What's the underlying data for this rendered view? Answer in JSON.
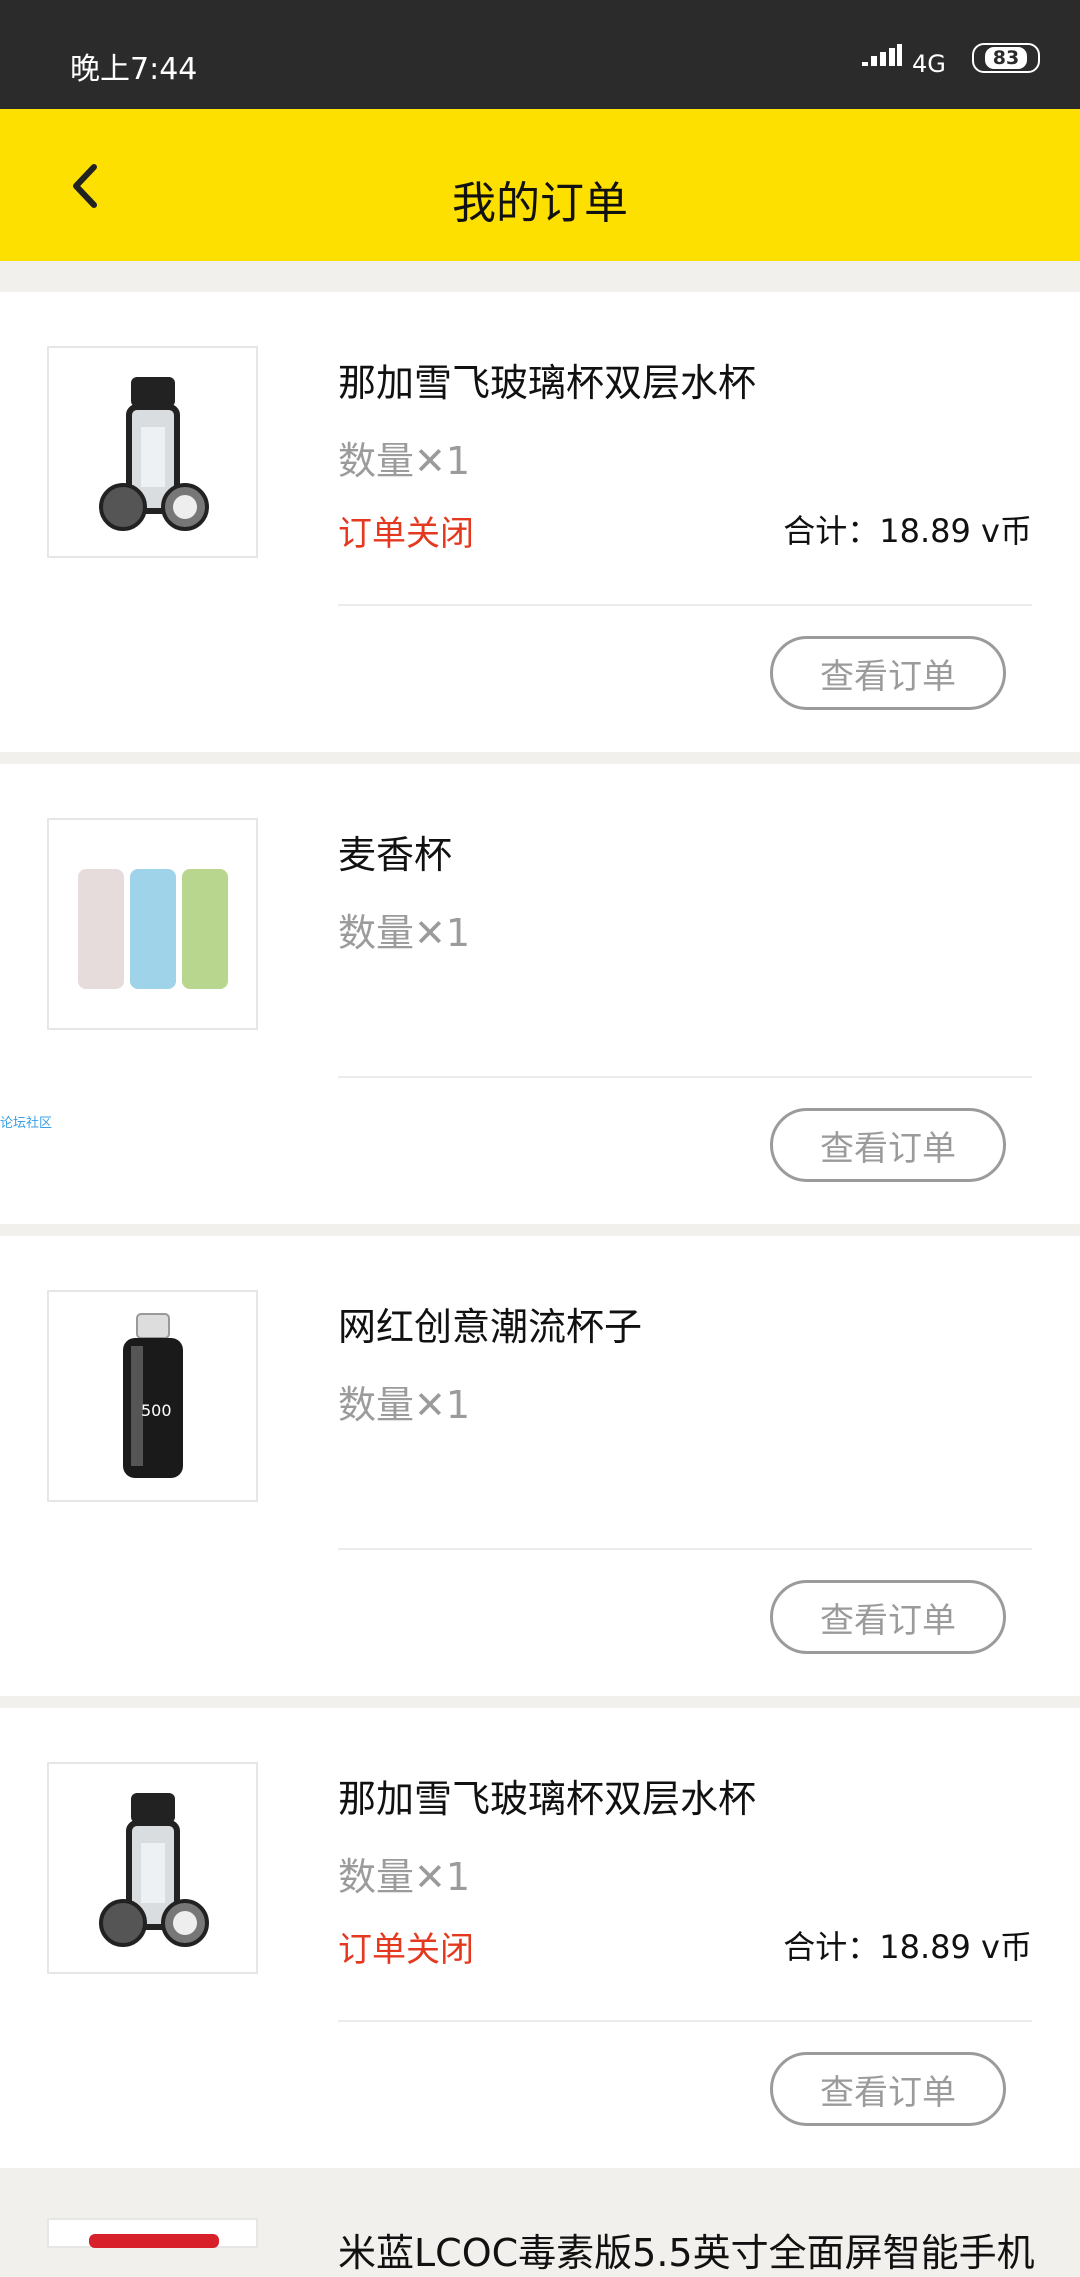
{
  "status_bar": {
    "time": "晚上7:44",
    "network": "4G",
    "battery": "83"
  },
  "header": {
    "title": "我的订单"
  },
  "orders": [
    {
      "name": "那加雪飞玻璃杯双层水杯",
      "quantity": "数量✕1",
      "status": "订单关闭",
      "total": "合计：18.89 v币",
      "button": "查看订单",
      "image": "black-bottle"
    },
    {
      "name": "麦香杯",
      "quantity": "数量✕1",
      "status": "",
      "total": "",
      "button": "查看订单",
      "image": "three-cups"
    },
    {
      "name": "网红创意潮流杯子",
      "quantity": "数量✕1",
      "status": "",
      "total": "",
      "button": "查看订单",
      "image": "glass-bottle"
    },
    {
      "name": "那加雪飞玻璃杯双层水杯",
      "quantity": "数量✕1",
      "status": "订单关闭",
      "total": "合计：18.89 v币",
      "button": "查看订单",
      "image": "black-bottle"
    }
  ],
  "partial_order": {
    "name": "米蓝LCOC毒素版5.5英寸全面屏智能手机"
  },
  "side_link": "论坛社区",
  "colors": {
    "accent": "#fde000",
    "status_closed": "#e5391f",
    "statusbar": "#2b2b2b"
  }
}
